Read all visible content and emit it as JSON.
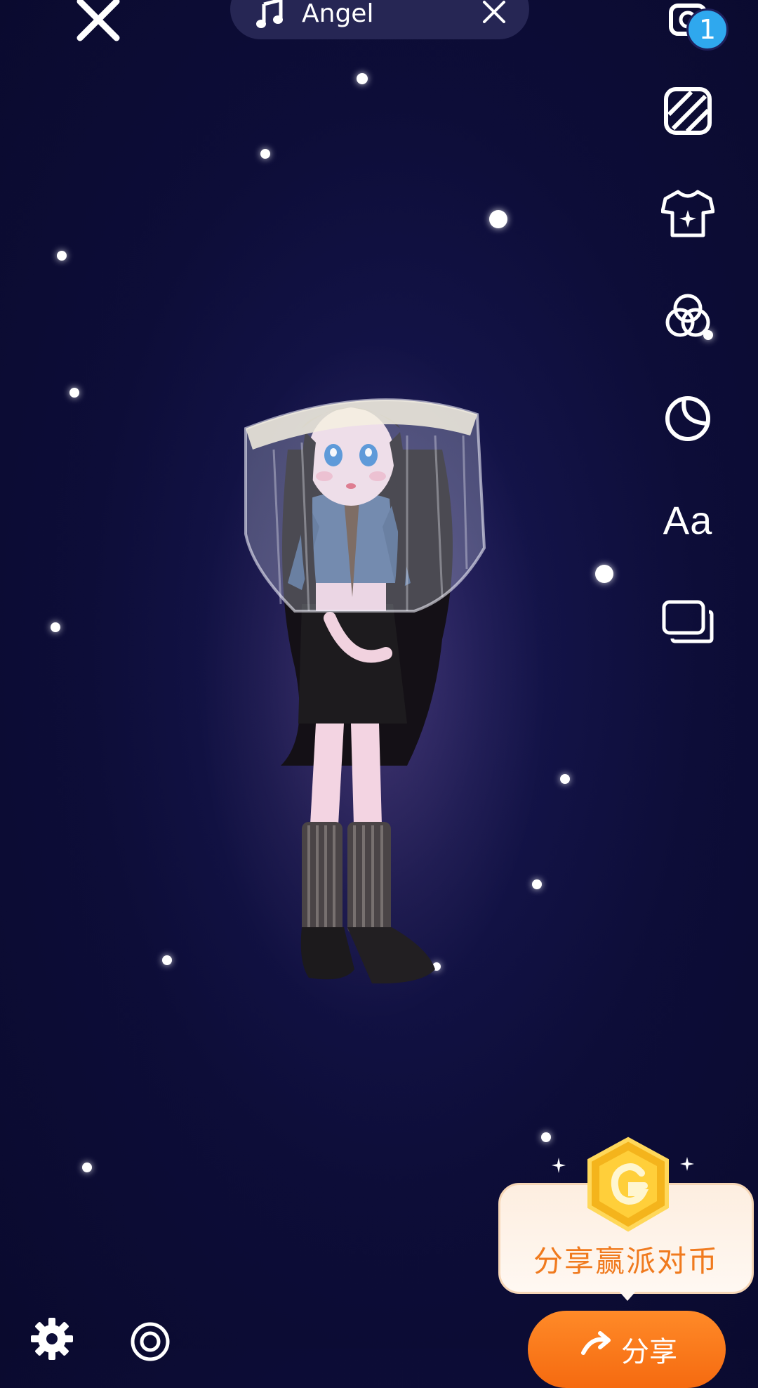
{
  "top_bar": {
    "close_icon": "close-icon",
    "music": {
      "icon": "music-note-icon",
      "title": "Angel",
      "close_icon": "close-icon"
    }
  },
  "toolbar": {
    "badge_count": "1",
    "items": [
      {
        "name": "camera-icon"
      },
      {
        "name": "background-pattern-icon"
      },
      {
        "name": "outfit-icon"
      },
      {
        "name": "filter-icon"
      },
      {
        "name": "sticker-icon"
      },
      {
        "name": "text-tool",
        "label": "Aa"
      },
      {
        "name": "layers-icon"
      }
    ]
  },
  "promo": {
    "text": "分享赢派对币",
    "coin_icon": "coin-icon"
  },
  "share_button": {
    "label": "分享"
  },
  "bottom": {
    "settings_icon": "gear-icon",
    "record_icon": "record-icon"
  },
  "colors": {
    "background": "#0a0a2e",
    "accent": "#f56a10",
    "badge": "#2fa8ee"
  }
}
